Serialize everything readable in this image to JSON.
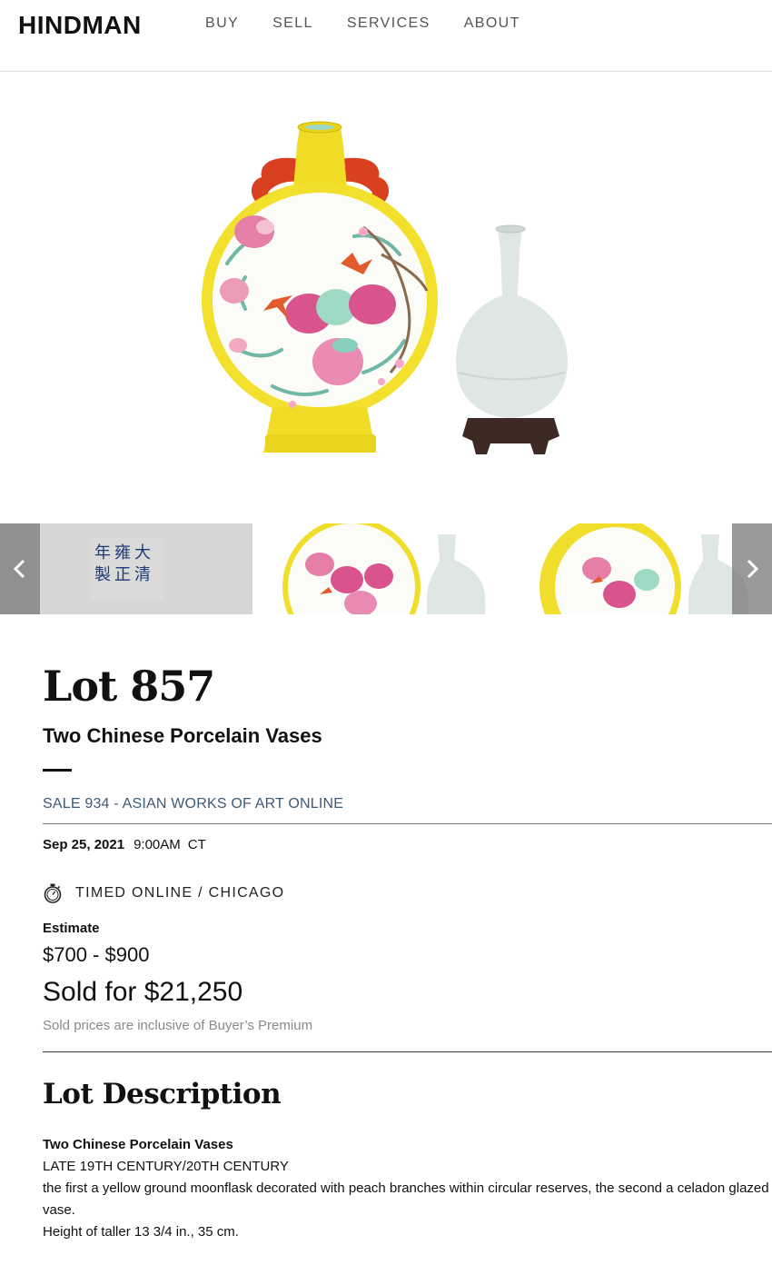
{
  "header": {
    "logo": "HINDMAN",
    "nav": [
      "BUY",
      "SELL",
      "SERVICES",
      "ABOUT"
    ]
  },
  "lot": {
    "title": "Lot 857",
    "subtitle": "Two Chinese Porcelain Vases",
    "sale_link": "SALE 934 - ASIAN WORKS OF ART ONLINE",
    "date": "Sep 25, 2021",
    "time": "9:00AM",
    "timezone": "CT",
    "auction_type": "TIMED ONLINE / CHICAGO",
    "estimate_label": "Estimate",
    "estimate_value": "$700 - $900",
    "sold_for": "Sold for $21,250",
    "sold_note": "Sold prices are inclusive of Buyer’s Premium"
  },
  "description": {
    "heading": "Lot Description",
    "title": "Two Chinese Porcelain Vases",
    "period": "LATE 19TH CENTURY/20TH CENTURY",
    "text": "the first a yellow ground moonflask decorated with peach branches within circular reserves, the second a celadon glazed vase.",
    "dimensions": "Height of taller 13 3/4 in., 35 cm."
  },
  "icons": {
    "timer": "stopwatch-icon",
    "prev": "chevron-left-icon",
    "next": "chevron-right-icon"
  },
  "colors": {
    "accent_link": "#3d5a78",
    "moonflask_yellow": "#f2df2a",
    "celadon": "#dfe7e4"
  }
}
